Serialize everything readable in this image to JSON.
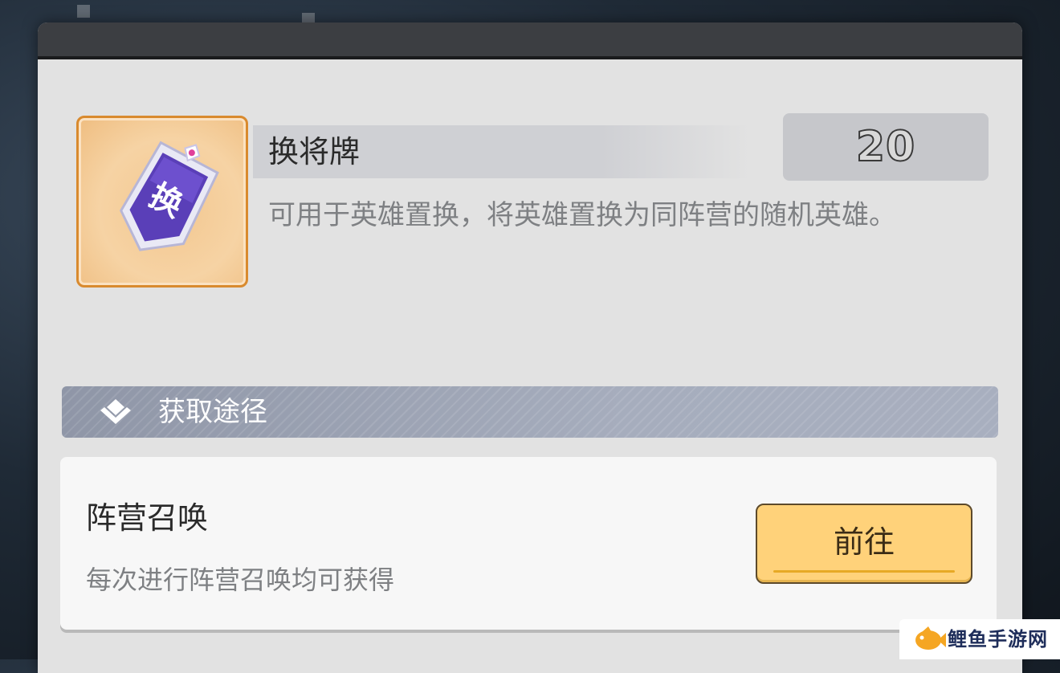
{
  "item": {
    "name": "换将牌",
    "quantity": "20",
    "description": "可用于英雄置换，将英雄置换为同阵营的随机英雄。",
    "icon_glyph": "换",
    "icon": "swap-card-icon"
  },
  "acquire_section": {
    "title": "获取途径",
    "icon": "diamond-stack-icon"
  },
  "source": {
    "title": "阵营召唤",
    "description": "每次进行阵营召唤均可获得",
    "button_label": "前往"
  },
  "watermark": {
    "text": "鲤鱼手游网",
    "icon": "fish-logo-icon"
  },
  "colors": {
    "accent_button": "#ffd27a",
    "icon_frame": "#d98a2e",
    "section_header": "#9aa1b2"
  }
}
